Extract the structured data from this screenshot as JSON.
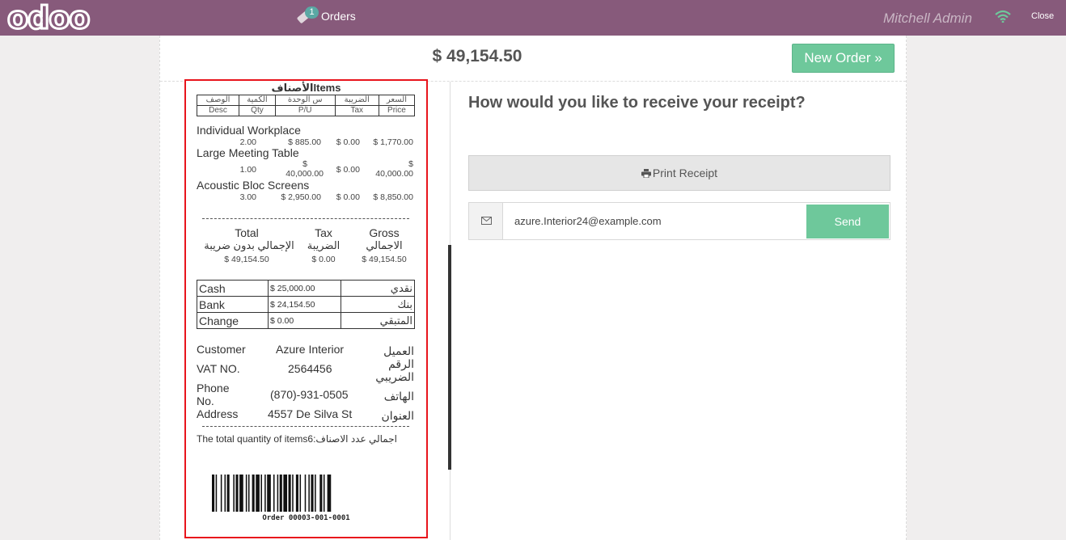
{
  "navbar": {
    "logo": "odoo",
    "orders_count": "1",
    "orders_label": "Orders",
    "user": "Mitchell Admin",
    "close_label": "Close"
  },
  "top_bar": {
    "total": "$ 49,154.50",
    "new_order_label": "New Order »"
  },
  "receipt": {
    "title": "الأصنافItems",
    "header_ar": [
      "الوصف",
      "الكمية",
      "س الوحدة",
      "الضريبة",
      "السعر"
    ],
    "header_en": [
      "Desc",
      "Qty",
      "P/U",
      "Tax",
      "Price"
    ],
    "items": [
      {
        "name": "Individual Workplace",
        "qty": "2.00",
        "price_unit": "$ 885.00",
        "tax": "$ 0.00",
        "price": "$ 1,770.00"
      },
      {
        "name": "Large Meeting Table",
        "qty": "1.00",
        "price_unit_1": "$",
        "price_unit_2": "40,000.00",
        "tax": "$ 0.00",
        "price_1": "$",
        "price_2": "40,000.00"
      },
      {
        "name": "Acoustic Bloc Screens",
        "qty": "3.00",
        "price_unit": "$ 2,950.00",
        "tax": "$ 0.00",
        "price": "$ 8,850.00"
      }
    ],
    "separator": "------------------------------------------------------",
    "totals": {
      "total_label": "Total",
      "total_ar": "الإجمالي بدون ضريبة",
      "total_value": "$ 49,154.50",
      "tax_label": "Tax",
      "tax_ar": "الضريبة",
      "tax_value": "$ 0.00",
      "gross_label": "Gross",
      "gross_ar": "الاجمالي",
      "gross_value": "$ 49,154.50"
    },
    "payments": [
      {
        "label": "Cash",
        "amount": "$ 25,000.00",
        "ar": "نقدي"
      },
      {
        "label": "Bank",
        "amount": "$ 24,154.50",
        "ar": "بنك"
      },
      {
        "label": "Change",
        "amount": "$ 0.00",
        "ar": "المتبقي"
      }
    ],
    "customer": {
      "customer_label": "Customer",
      "customer_value": "Azure Interior",
      "customer_ar": "العميل",
      "vat_label": "VAT NO.",
      "vat_value": "2564456",
      "vat_ar_1": "الرقم",
      "vat_ar_2": "الضريبي",
      "phone_label_1": "Phone",
      "phone_label_2": "No.",
      "phone_value": "(870)-931-0505",
      "phone_ar": "الهاتف",
      "address_label": "Address",
      "address_value": "4557 De Silva St",
      "address_ar": "العنوان"
    },
    "total_qty_text": "The total quantity of items6:اجمالي عدد الاصناف",
    "order_ref": "Order 00003-001-0001"
  },
  "right_panel": {
    "prompt": "How would you like to receive your receipt?",
    "print_label": "Print Receipt",
    "email_value": "azure.Interior24@example.com",
    "send_label": "Send"
  },
  "colors": {
    "navbar": "#875a7b",
    "accent_green": "#6ec89b",
    "receipt_border": "#e8141c",
    "badge": "#5aa8a4"
  }
}
